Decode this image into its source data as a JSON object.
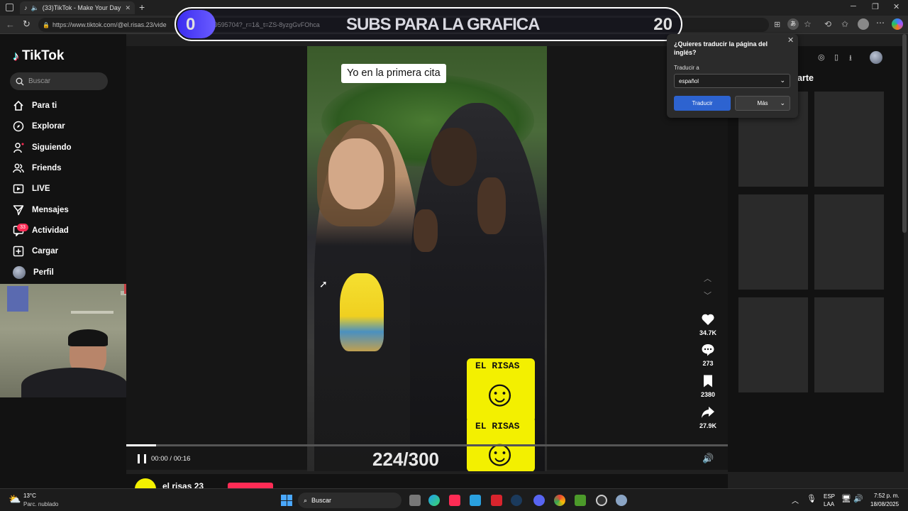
{
  "browser": {
    "tab_title": "(33)TikTok - Make Your Day",
    "url_prefix": "https://www.tiktok.com/@el.risas.23/vide",
    "url_suffix": "4289595704?_r=1&_t=ZS-8yzgGvFOhca"
  },
  "overlay": {
    "subs_text": "SUBS PARA LA GRAFICA",
    "subs_start": "0",
    "subs_goal": "20"
  },
  "sidebar": {
    "logo_text": "TikTok",
    "search_placeholder": "Buscar",
    "items": [
      {
        "label": "Para ti",
        "icon": "home-icon"
      },
      {
        "label": "Explorar",
        "icon": "compass-icon"
      },
      {
        "label": "Siguiendo",
        "icon": "following-icon"
      },
      {
        "label": "Friends",
        "icon": "friends-icon"
      },
      {
        "label": "LIVE",
        "icon": "live-icon"
      },
      {
        "label": "Mensajes",
        "icon": "messages-icon"
      },
      {
        "label": "Actividad",
        "icon": "activity-icon"
      },
      {
        "label": "Cargar",
        "icon": "upload-icon"
      },
      {
        "label": "Perfil",
        "icon": "avatar"
      }
    ],
    "activity_badge": "33"
  },
  "video": {
    "caption": "Yo en la primera cita",
    "counter": "224/300",
    "sticker_text": "EL RISAS",
    "time": "00:00 / 00:16",
    "progress": 0.05
  },
  "actions": {
    "likes": "34.7K",
    "comments": "273",
    "saves": "2380",
    "shares": "27.9K"
  },
  "author": {
    "name": "el risas 23"
  },
  "right_panel": {
    "heading_partial": "arte"
  },
  "translate_popup": {
    "title": "¿Quieres traducir la página del inglés?",
    "label": "Traducir a",
    "selected": "español",
    "translate_button": "Traducir",
    "more_button": "Más"
  },
  "taskbar": {
    "weather_temp": "13°C",
    "weather_desc": "Parc. nublado",
    "search": "Buscar",
    "lang1": "ESP",
    "lang2": "LAA",
    "time": "7:52 p. m.",
    "date": "18/08/2025"
  },
  "colors": {
    "accent": "#fe2c55",
    "translate_blue": "#2d63d0",
    "sticker_yellow": "#f3f000"
  }
}
